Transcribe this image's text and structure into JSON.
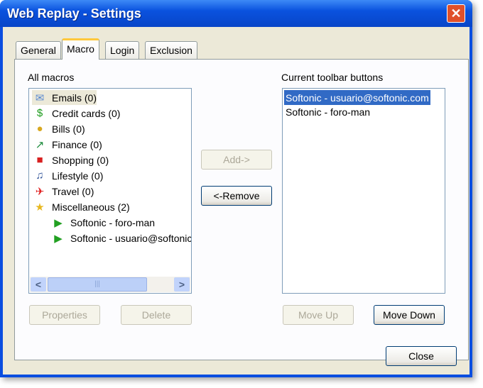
{
  "window": {
    "title": "Web Replay - Settings",
    "close_glyph": "✕"
  },
  "tabs": [
    {
      "label": "General"
    },
    {
      "label": "Macro"
    },
    {
      "label": "Login"
    },
    {
      "label": "Exclusion"
    }
  ],
  "all_macros": {
    "label": "All macros",
    "items": [
      {
        "label": "Emails (0)",
        "icon": "envelope-icon",
        "glyph": "✉",
        "color": "#5a8ad0"
      },
      {
        "label": "Credit cards (0)",
        "icon": "dollar-icon",
        "glyph": "$",
        "color": "#1a9a1a"
      },
      {
        "label": "Bills (0)",
        "icon": "coins-icon",
        "glyph": "●",
        "color": "#d8a820"
      },
      {
        "label": "Finance (0)",
        "icon": "chart-up-icon",
        "glyph": "↗",
        "color": "#1a8a3a"
      },
      {
        "label": "Shopping (0)",
        "icon": "bag-icon",
        "glyph": "■",
        "color": "#d82020"
      },
      {
        "label": "Lifestyle (0)",
        "icon": "lifestyle-icon",
        "glyph": "♫",
        "color": "#335599"
      },
      {
        "label": "Travel (0)",
        "icon": "airplane-icon",
        "glyph": "✈",
        "color": "#e02020"
      },
      {
        "label": "Miscellaneous (2)",
        "icon": "star-icon",
        "glyph": "★",
        "color": "#e8b820"
      }
    ],
    "children": [
      {
        "label": "Softonic - foro-man"
      },
      {
        "label": "Softonic - usuario@softonic.com"
      }
    ]
  },
  "buttons": {
    "add": "Add->",
    "remove": "<-Remove",
    "properties": "Properties",
    "delete": "Delete",
    "move_up": "Move Up",
    "move_down": "Move Down",
    "close": "Close",
    "scroll_left": "<",
    "scroll_right": ">",
    "grip": "|||"
  },
  "toolbar": {
    "label": "Current toolbar buttons",
    "items": [
      {
        "label": "Softonic - usuario@softonic.com"
      },
      {
        "label": "Softonic - foro-man"
      }
    ]
  }
}
